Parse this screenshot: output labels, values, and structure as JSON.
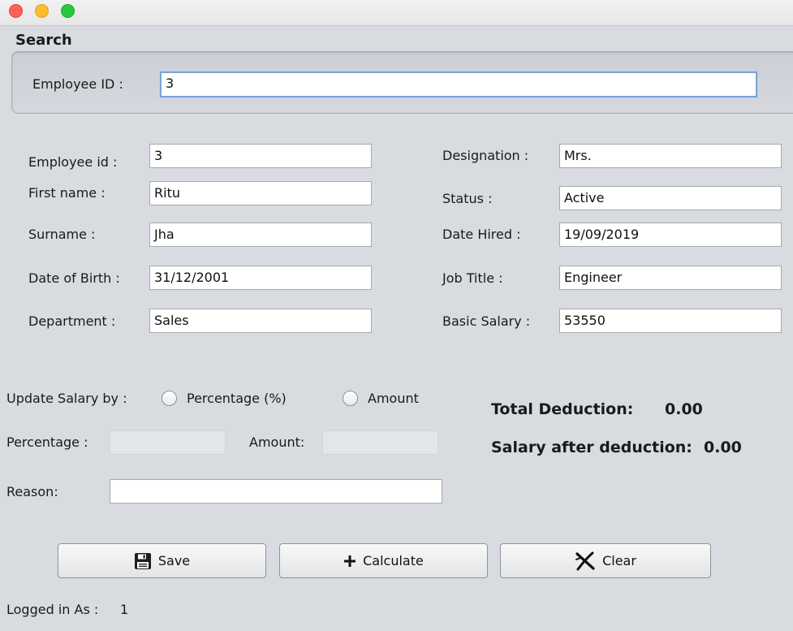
{
  "search": {
    "legend": "Search",
    "employee_id_label": "Employee ID :",
    "employee_id_value": "3"
  },
  "details": {
    "employee_id_label": "Employee id :",
    "employee_id_value": "3",
    "first_name_label": "First name :",
    "first_name_value": "Ritu",
    "surname_label": "Surname :",
    "surname_value": "Jha",
    "dob_label": "Date of Birth :",
    "dob_value": "31/12/2001",
    "department_label": "Department :",
    "department_value": "Sales",
    "designation_label": "Designation :",
    "designation_value": "Mrs.",
    "status_label": "Status :",
    "status_value": "Active",
    "date_hired_label": "Date Hired :",
    "date_hired_value": "19/09/2019",
    "job_title_label": "Job Title :",
    "job_title_value": "Engineer",
    "basic_salary_label": "Basic Salary :",
    "basic_salary_value": "53550"
  },
  "update": {
    "label": "Update Salary by :",
    "option_percentage": "Percentage (%)",
    "option_amount": "Amount",
    "percentage_label": "Percentage :",
    "percentage_value": "",
    "amount_label": "Amount:",
    "amount_value": "",
    "reason_label": "Reason:",
    "reason_value": ""
  },
  "summary": {
    "total_deduction_label": "Total Deduction:",
    "total_deduction_value": "0.00",
    "salary_after_label": "Salary after deduction:",
    "salary_after_value": "0.00"
  },
  "buttons": {
    "save": "Save",
    "calculate": "Calculate",
    "clear": "Clear",
    "save_icon": "floppy-disk-icon",
    "calculate_icon": "plus-icon",
    "clear_icon": "x-icon"
  },
  "footer": {
    "logged_in_label": "Logged in As :",
    "logged_in_value": "1"
  },
  "colors": {
    "background": "#d8dbe0",
    "focus_border": "#7aa4d8",
    "close": "#fe5f57",
    "minimize": "#febc2e",
    "zoom": "#28c840"
  }
}
